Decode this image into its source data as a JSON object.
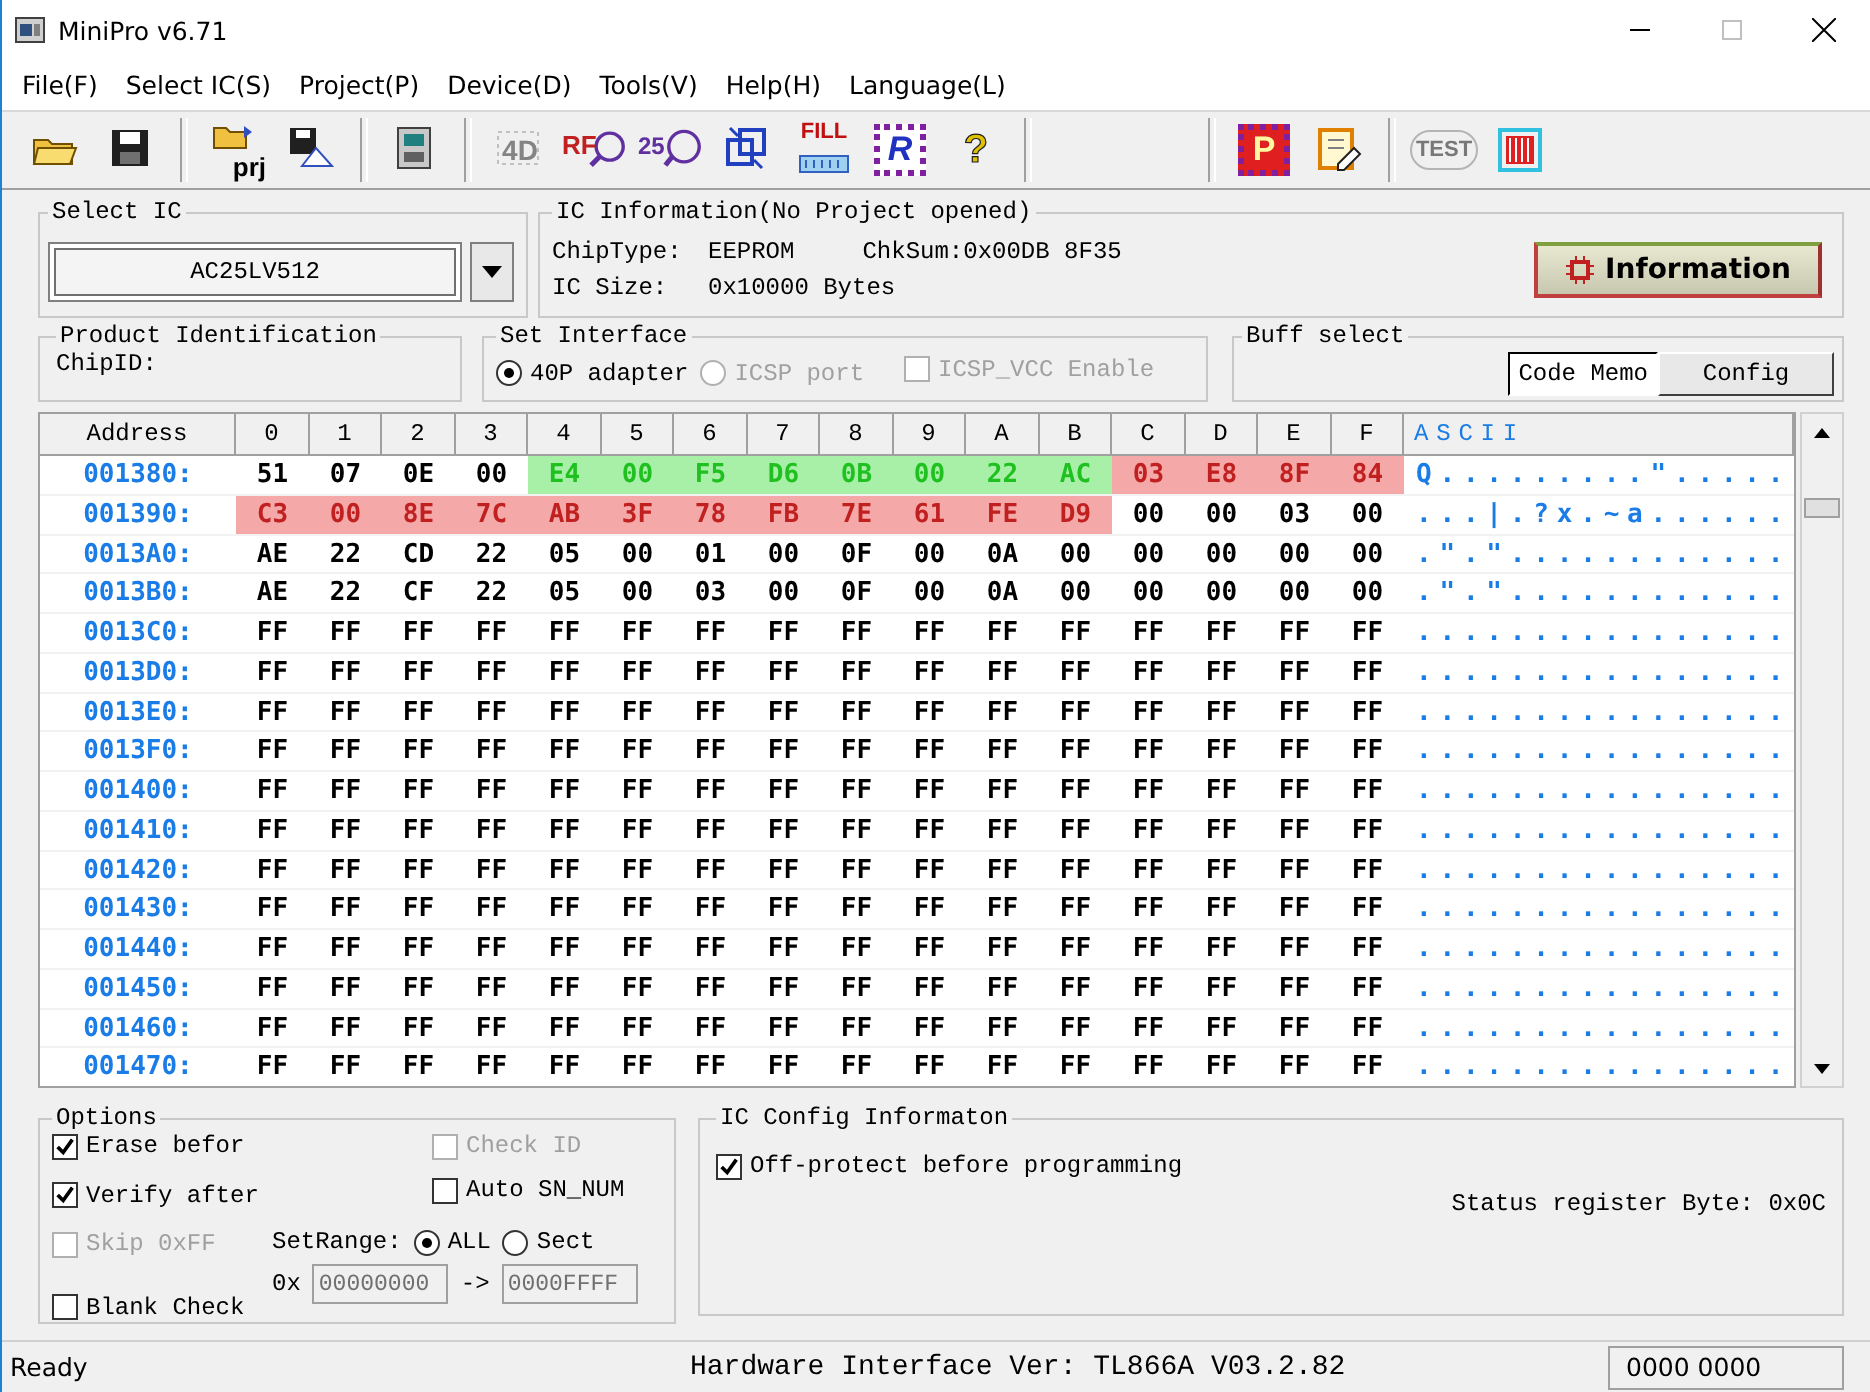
{
  "window": {
    "title": "MiniPro v6.71"
  },
  "menu": [
    "File(F)",
    "Select IC(S)",
    "Project(P)",
    "Device(D)",
    "Tools(V)",
    "Help(H)",
    "Language(L)"
  ],
  "toolbar": [
    [
      {
        "kind": "folder",
        "disabled": false
      },
      {
        "kind": "floppy",
        "disabled": false
      }
    ],
    [
      {
        "kind": "folder-prj",
        "label": "prj",
        "disabled": false
      },
      {
        "kind": "floppy-picture",
        "disabled": false
      }
    ],
    [
      {
        "kind": "device",
        "disabled": false
      }
    ],
    [
      {
        "kind": "read-id",
        "label": "4D",
        "disabled": true
      },
      {
        "kind": "magnifier",
        "label": "RF",
        "disabled": false
      },
      {
        "kind": "magnifier-circle",
        "label": "25",
        "disabled": false
      },
      {
        "kind": "blank-check",
        "disabled": false
      },
      {
        "kind": "fill",
        "label": "FILL",
        "disabled": false
      },
      {
        "kind": "chip-outline",
        "label": "R",
        "disabled": false
      },
      {
        "kind": "help",
        "label": "?",
        "disabled": false
      }
    ],
    [
      {
        "kind": "chip-solid",
        "label": "P",
        "disabled": false
      },
      {
        "kind": "edit",
        "disabled": false
      }
    ],
    [
      {
        "kind": "test",
        "label": "TEST",
        "disabled": true
      },
      {
        "kind": "chip-grid",
        "disabled": false
      }
    ]
  ],
  "select_ic": {
    "title": "Select IC",
    "value": "AC25LV512"
  },
  "ic_info": {
    "title": "IC Information(No Project opened)",
    "chip_type_label": "ChipType:",
    "chip_type": "EEPROM",
    "checksum": "ChkSum:0x00DB 8F35",
    "size_label": "IC Size:",
    "size": "0x10000 Bytes",
    "button": "Information"
  },
  "product_id": {
    "title": "Product Identification",
    "chip_id_label": "ChipID:"
  },
  "interface": {
    "title": "Set Interface",
    "options": [
      {
        "kind": "radio",
        "label": "40P adapter",
        "selected": true,
        "disabled": false
      },
      {
        "kind": "radio",
        "label": "ICSP port",
        "selected": false,
        "disabled": true
      },
      {
        "kind": "checkbox",
        "label": "ICSP_VCC Enable",
        "checked": false,
        "disabled": true
      }
    ]
  },
  "buff_select": {
    "title": "Buff select",
    "tabs": [
      {
        "label": "Code Memo",
        "selected": true
      },
      {
        "label": "Config",
        "selected": false
      }
    ]
  },
  "hex": {
    "address_header": "Address",
    "columns": [
      "0",
      "1",
      "2",
      "3",
      "4",
      "5",
      "6",
      "7",
      "8",
      "9",
      "A",
      "B",
      "C",
      "D",
      "E",
      "F"
    ],
    "ascii_header": "ASCII",
    "rows": [
      {
        "address": "001380:",
        "cells": [
          "51",
          "07",
          "0E",
          "00",
          {
            "value": "E4",
            "color": "#a8f0a8"
          },
          {
            "value": "00",
            "color": "#a8f0a8"
          },
          {
            "value": "F5",
            "color": "#a8f0a8"
          },
          {
            "value": "D6",
            "color": "#a8f0a8"
          },
          {
            "value": "0B",
            "color": "#a8f0a8"
          },
          {
            "value": "00",
            "color": "#a8f0a8"
          },
          {
            "value": "22",
            "color": "#a8f0a8"
          },
          {
            "value": "AC",
            "color": "#a8f0a8"
          },
          {
            "value": "03",
            "color": "#f4a8a8"
          },
          {
            "value": "E8",
            "color": "#f4a8a8"
          },
          {
            "value": "8F",
            "color": "#f4a8a8"
          },
          {
            "value": "84",
            "color": "#f4a8a8"
          }
        ],
        "ascii": "Q.........\"....."
      },
      {
        "address": "001390:",
        "cells": [
          {
            "value": "C3",
            "color": "#f4a8a8"
          },
          {
            "value": "00",
            "color": "#f4a8a8"
          },
          {
            "value": "8E",
            "color": "#f4a8a8"
          },
          {
            "value": "7C",
            "color": "#f4a8a8"
          },
          {
            "value": "AB",
            "color": "#f4a8a8"
          },
          {
            "value": "3F",
            "color": "#f4a8a8"
          },
          {
            "value": "78",
            "color": "#f4a8a8"
          },
          {
            "value": "FB",
            "color": "#f4a8a8"
          },
          {
            "value": "7E",
            "color": "#f4a8a8"
          },
          {
            "value": "61",
            "color": "#f4a8a8"
          },
          {
            "value": "FE",
            "color": "#f4a8a8"
          },
          {
            "value": "D9",
            "color": "#f4a8a8"
          },
          "00",
          "00",
          "03",
          "00"
        ],
        "ascii": "...|.?x.~a......"
      },
      {
        "address": "0013A0:",
        "cells": [
          "AE",
          "22",
          "CD",
          "22",
          "05",
          "00",
          "01",
          "00",
          "0F",
          "00",
          "0A",
          "00",
          "00",
          "00",
          "00",
          "00"
        ],
        "ascii": ".\".\"............"
      },
      {
        "address": "0013B0:",
        "cells": [
          "AE",
          "22",
          "CF",
          "22",
          "05",
          "00",
          "03",
          "00",
          "0F",
          "00",
          "0A",
          "00",
          "00",
          "00",
          "00",
          "00"
        ],
        "ascii": ".\".\"............"
      },
      {
        "address": "0013C0:",
        "cells": [
          "FF",
          "FF",
          "FF",
          "FF",
          "FF",
          "FF",
          "FF",
          "FF",
          "FF",
          "FF",
          "FF",
          "FF",
          "FF",
          "FF",
          "FF",
          "FF"
        ],
        "ascii": "................"
      },
      {
        "address": "0013D0:",
        "cells": [
          "FF",
          "FF",
          "FF",
          "FF",
          "FF",
          "FF",
          "FF",
          "FF",
          "FF",
          "FF",
          "FF",
          "FF",
          "FF",
          "FF",
          "FF",
          "FF"
        ],
        "ascii": "................"
      },
      {
        "address": "0013E0:",
        "cells": [
          "FF",
          "FF",
          "FF",
          "FF",
          "FF",
          "FF",
          "FF",
          "FF",
          "FF",
          "FF",
          "FF",
          "FF",
          "FF",
          "FF",
          "FF",
          "FF"
        ],
        "ascii": "................"
      },
      {
        "address": "0013F0:",
        "cells": [
          "FF",
          "FF",
          "FF",
          "FF",
          "FF",
          "FF",
          "FF",
          "FF",
          "FF",
          "FF",
          "FF",
          "FF",
          "FF",
          "FF",
          "FF",
          "FF"
        ],
        "ascii": "................"
      },
      {
        "address": "001400:",
        "cells": [
          "FF",
          "FF",
          "FF",
          "FF",
          "FF",
          "FF",
          "FF",
          "FF",
          "FF",
          "FF",
          "FF",
          "FF",
          "FF",
          "FF",
          "FF",
          "FF"
        ],
        "ascii": "................"
      },
      {
        "address": "001410:",
        "cells": [
          "FF",
          "FF",
          "FF",
          "FF",
          "FF",
          "FF",
          "FF",
          "FF",
          "FF",
          "FF",
          "FF",
          "FF",
          "FF",
          "FF",
          "FF",
          "FF"
        ],
        "ascii": "................"
      },
      {
        "address": "001420:",
        "cells": [
          "FF",
          "FF",
          "FF",
          "FF",
          "FF",
          "FF",
          "FF",
          "FF",
          "FF",
          "FF",
          "FF",
          "FF",
          "FF",
          "FF",
          "FF",
          "FF"
        ],
        "ascii": "................"
      },
      {
        "address": "001430:",
        "cells": [
          "FF",
          "FF",
          "FF",
          "FF",
          "FF",
          "FF",
          "FF",
          "FF",
          "FF",
          "FF",
          "FF",
          "FF",
          "FF",
          "FF",
          "FF",
          "FF"
        ],
        "ascii": "................"
      },
      {
        "address": "001440:",
        "cells": [
          "FF",
          "FF",
          "FF",
          "FF",
          "FF",
          "FF",
          "FF",
          "FF",
          "FF",
          "FF",
          "FF",
          "FF",
          "FF",
          "FF",
          "FF",
          "FF"
        ],
        "ascii": "................"
      },
      {
        "address": "001450:",
        "cells": [
          "FF",
          "FF",
          "FF",
          "FF",
          "FF",
          "FF",
          "FF",
          "FF",
          "FF",
          "FF",
          "FF",
          "FF",
          "FF",
          "FF",
          "FF",
          "FF"
        ],
        "ascii": "................"
      },
      {
        "address": "001460:",
        "cells": [
          "FF",
          "FF",
          "FF",
          "FF",
          "FF",
          "FF",
          "FF",
          "FF",
          "FF",
          "FF",
          "FF",
          "FF",
          "FF",
          "FF",
          "FF",
          "FF"
        ],
        "ascii": "................"
      },
      {
        "address": "001470:",
        "cells": [
          "FF",
          "FF",
          "FF",
          "FF",
          "FF",
          "FF",
          "FF",
          "FF",
          "FF",
          "FF",
          "FF",
          "FF",
          "FF",
          "FF",
          "FF",
          "FF"
        ],
        "ascii": "................"
      }
    ]
  },
  "options": {
    "title": "Options",
    "left": [
      {
        "label": "Erase befor",
        "checked": true,
        "disabled": false
      },
      {
        "label": "Verify after",
        "checked": true,
        "disabled": false
      },
      {
        "label": "Skip 0xFF",
        "checked": false,
        "disabled": true
      },
      {
        "label": "Blank Check",
        "checked": false,
        "disabled": false
      }
    ],
    "right": [
      {
        "label": "Check ID",
        "checked": false,
        "disabled": true
      },
      {
        "label": "Auto SN_NUM",
        "checked": false,
        "disabled": false
      }
    ],
    "set_range": {
      "label": "SetRange:",
      "choices": [
        {
          "label": "ALL",
          "selected": true
        },
        {
          "label": "Sect",
          "selected": false
        }
      ],
      "prefix": "0x",
      "from": "00000000",
      "arrow": "->",
      "to": "0000FFFF"
    }
  },
  "ic_config": {
    "title": "IC Config Informaton",
    "checkbox": {
      "label": "Off-protect before programming",
      "checked": true
    },
    "status": "Status register Byte: 0x0C"
  },
  "status_bar": {
    "message": "Ready",
    "hardware": "Hardware Interface Ver: TL866A V03.2.82",
    "counter": "0000 0000"
  }
}
